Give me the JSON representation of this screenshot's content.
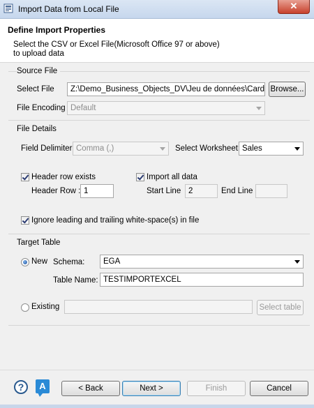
{
  "window": {
    "title": "Import Data from Local File",
    "close_label": "✕"
  },
  "header": {
    "title": "Define Import Properties",
    "description": "Select the CSV or Excel File(Microsoft Office 97 or above) to upload data"
  },
  "source_file": {
    "section_title": "Source File",
    "select_file_label": "Select File",
    "select_file_value": "Z:\\Demo_Business_Objects_DV\\Jeu de données\\Card - I",
    "browse_label": "Browse...",
    "encoding_label": "File Encoding",
    "encoding_value": "Default"
  },
  "file_details": {
    "section_title": "File Details",
    "field_delimiter_label": "Field Delimiter",
    "field_delimiter_value": "Comma (,)",
    "select_worksheet_label": "Select Worksheet:",
    "select_worksheet_value": "Sales",
    "header_row_exists_label": "Header row exists",
    "header_row_exists_checked": true,
    "header_row_label": "Header Row :",
    "header_row_value": "1",
    "import_all_label": "Import all data",
    "import_all_checked": true,
    "start_line_label": "Start Line",
    "start_line_value": "2",
    "end_line_label": "End Line",
    "end_line_value": "",
    "ignore_whitespace_label": "Ignore leading and trailing white-space(s) in file",
    "ignore_whitespace_checked": true
  },
  "target_table": {
    "section_title": "Target Table",
    "new_label": "New",
    "new_selected": true,
    "schema_label": "Schema:",
    "schema_value": "EGA",
    "table_name_label": "Table Name:",
    "table_name_value": "TESTIMPORTEXCEL",
    "existing_label": "Existing",
    "existing_value": "",
    "select_table_label": "Select table"
  },
  "footer": {
    "help_glyph": "?",
    "assist_glyph": "A",
    "back_label": "< Back",
    "next_label": "Next >",
    "finish_label": "Finish",
    "cancel_label": "Cancel"
  }
}
